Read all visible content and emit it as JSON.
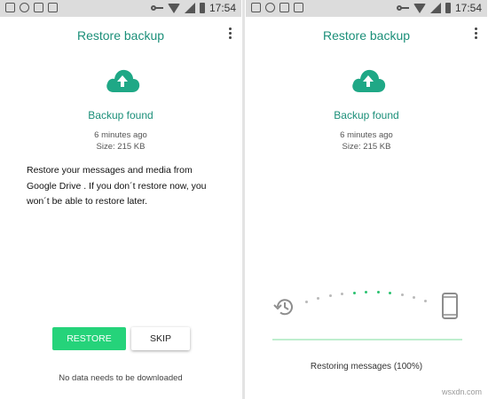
{
  "statusbar": {
    "time": "17:54"
  },
  "left_screen": {
    "title": "Restore backup",
    "backup_found": "Backup found",
    "age": "6 minutes ago",
    "size": "Size: 215 KB",
    "description_lines": [
      "Restore your messages and media from",
      "Google Drive . If you don´t restore now, you",
      "won´t be able to restore later."
    ],
    "restore_label": "RESTORE",
    "skip_label": "SKIP",
    "note": "No data needs to be downloaded"
  },
  "right_screen": {
    "title": "Restore backup",
    "backup_found": "Backup found",
    "age": "6 minutes ago",
    "size": "Size: 215 KB",
    "progress_fraction": 1.0,
    "status": "Restoring messages (100%)"
  },
  "icons": {
    "cloud": "cloud-upload-icon",
    "history": "history-icon",
    "phone": "smartphone-icon",
    "menu": "more-vert-icon"
  },
  "colors": {
    "accent": "#1b8f79",
    "button": "#25d37a",
    "cloud": "#1fa886",
    "progress_dot": "#2bc270"
  },
  "watermark": "wsxdn.com"
}
